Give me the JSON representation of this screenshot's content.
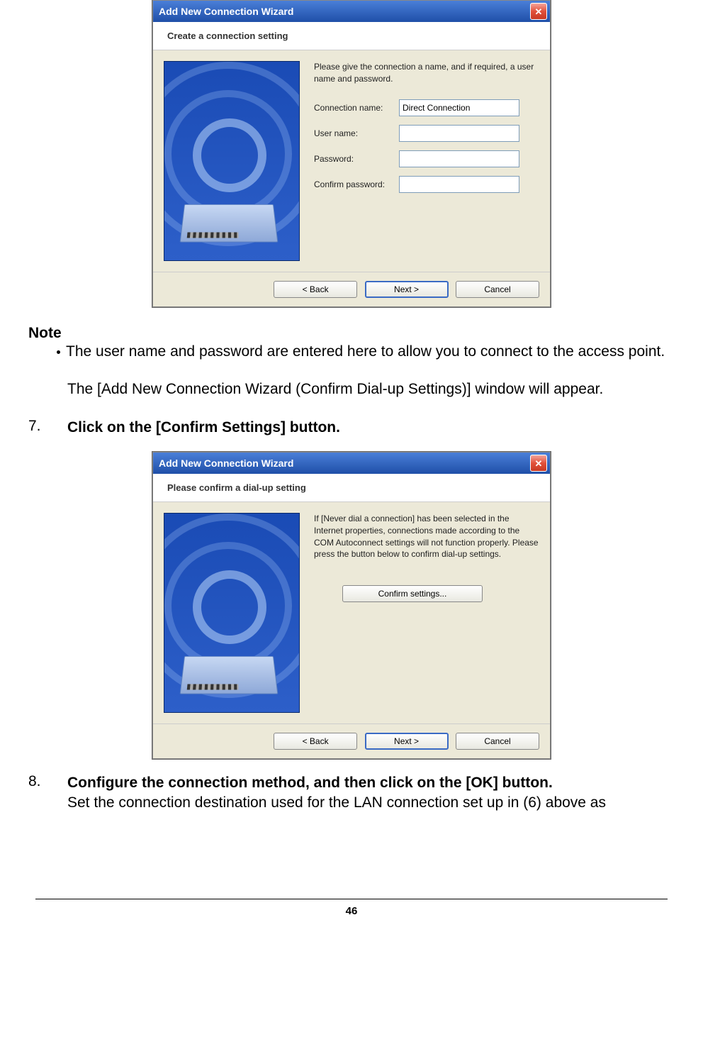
{
  "dialog1": {
    "title": "Add New Connection Wizard",
    "subtitle": "Create a connection setting",
    "description": "Please give the connection a name, and if required, a user name and password.",
    "fields": {
      "connName": {
        "label": "Connection name:",
        "value": "Direct Connection"
      },
      "userName": {
        "label": "User name:",
        "value": ""
      },
      "password": {
        "label": "Password:",
        "value": ""
      },
      "confirm": {
        "label": "Confirm password:",
        "value": ""
      }
    },
    "buttons": {
      "back": "< Back",
      "next": "Next >",
      "cancel": "Cancel"
    }
  },
  "note": {
    "heading": "Note",
    "bullet": "The user name and password are entered here to allow you to connect to the access point.",
    "followup": "The [Add New Connection Wizard (Confirm Dial-up Settings)] window will appear."
  },
  "step7": {
    "num": "7.",
    "text": "Click on the [Confirm Settings] button."
  },
  "dialog2": {
    "title": "Add New Connection Wizard",
    "subtitle": "Please confirm a dial-up setting",
    "description": "If [Never dial a connection] has been selected in the Internet properties, connections made according to the COM Autoconnect settings will not function properly. Please press the button below to confirm dial-up settings.",
    "confirmBtn": "Confirm settings...",
    "buttons": {
      "back": "< Back",
      "next": "Next >",
      "cancel": "Cancel"
    }
  },
  "step8": {
    "num": "8.",
    "bold": "Configure the connection method, and then click on the [OK] button.",
    "text": "Set the connection destination used for the LAN connection set up in (6) above as"
  },
  "pageNumber": "46"
}
